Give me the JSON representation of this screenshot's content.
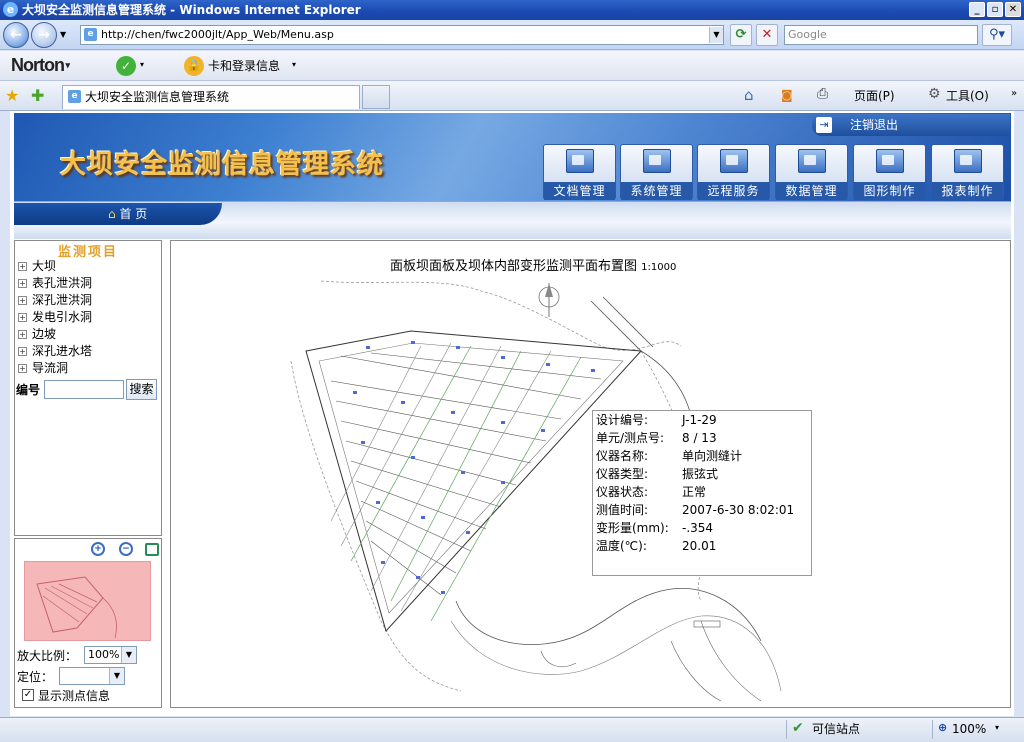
{
  "window": {
    "title": "大坝安全监测信息管理系统 - Windows Internet Explorer",
    "icon": "ie-icon"
  },
  "address": {
    "url": "http://chen/fwc2000jlt/App_Web/Menu.asp",
    "search_placeholder": "Google"
  },
  "toolbar": {
    "norton": "Norton",
    "card_login": "卡和登录信息",
    "page_menu": "页面(P)",
    "tools_menu": "工具(O)"
  },
  "tab": {
    "title": "大坝安全监测信息管理系统"
  },
  "banner": {
    "title": "大坝安全监测信息管理系统",
    "logout": "注销退出",
    "menus": [
      "文档管理",
      "系统管理",
      "远程服务",
      "数据管理",
      "图形制作",
      "报表制作"
    ]
  },
  "nav": {
    "home": "首 页"
  },
  "sidebar": {
    "title": "监测项目",
    "items": [
      "大坝",
      "表孔泄洪洞",
      "深孔泄洪洞",
      "发电引水洞",
      "边坡",
      "深孔进水塔",
      "导流洞"
    ],
    "code_label": "编号",
    "search_button": "搜索"
  },
  "thumbnail": {
    "zoom_label": "放大比例：",
    "zoom_value": "100%",
    "locate_label": "定位：",
    "locate_value": "",
    "show_points_label": "显示测点信息",
    "show_points_checked": true
  },
  "map": {
    "title": "面板坝面板及坝体内部变形监测平面布置图",
    "scale": "1:1000",
    "info": [
      {
        "key": "设计编号:",
        "value": "J-1-29"
      },
      {
        "key": "单元/测点号:",
        "value": "8 / 13"
      },
      {
        "key": "仪器名称:",
        "value": "单向测缝计"
      },
      {
        "key": "仪器类型:",
        "value": "振弦式"
      },
      {
        "key": "仪器状态:",
        "value": "正常"
      },
      {
        "key": "测值时间:",
        "value": "2007-6-30 8:02:01"
      },
      {
        "key": "变形量(mm):",
        "value": "-.354"
      },
      {
        "key": "温度(℃):",
        "value": "20.01"
      }
    ]
  },
  "status": {
    "zone": "可信站点",
    "zoom": "100%"
  }
}
